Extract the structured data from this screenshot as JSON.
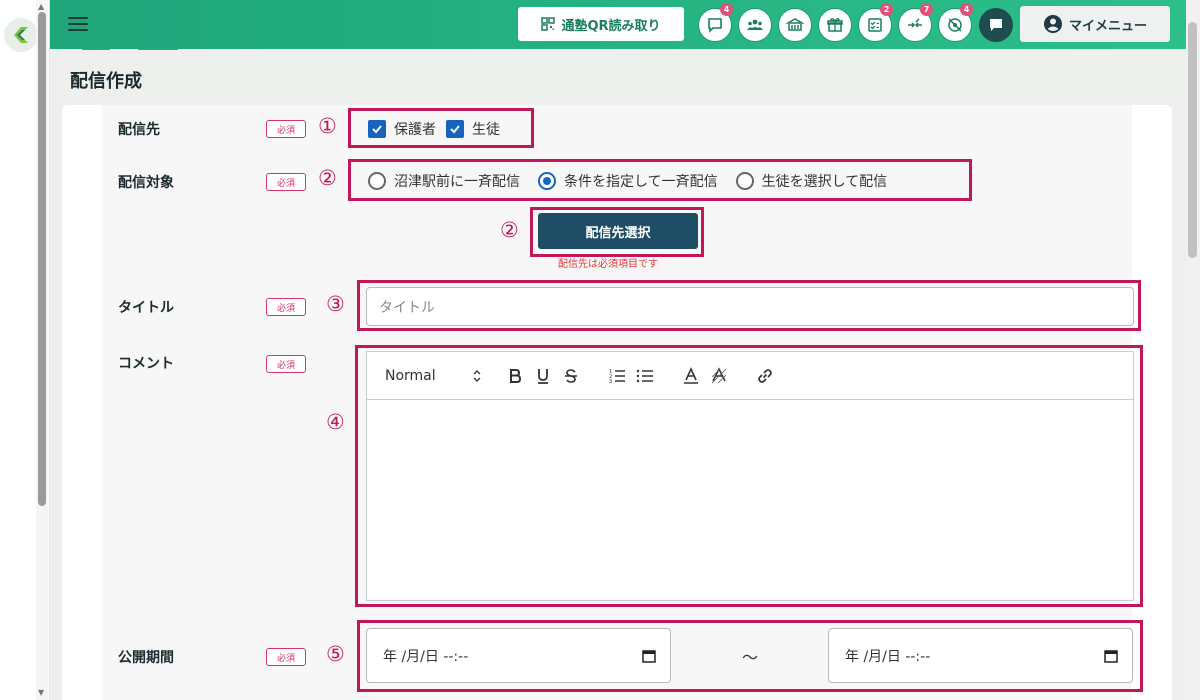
{
  "topbar": {
    "qr_button_label": "通塾QR読み取り",
    "icon_buttons": [
      {
        "name": "chat-icon",
        "badge": "4"
      },
      {
        "name": "group-icon",
        "badge": ""
      },
      {
        "name": "school-icon",
        "badge": ""
      },
      {
        "name": "gift-icon",
        "badge": ""
      },
      {
        "name": "checklist-icon",
        "badge": "2"
      },
      {
        "name": "transfer-icon",
        "badge": "7"
      },
      {
        "name": "location-off-icon",
        "badge": "4"
      }
    ],
    "mymenu_label": "マイメニュー"
  },
  "page": {
    "title": "配信作成"
  },
  "form": {
    "destination": {
      "label": "配信先",
      "required": "必須",
      "marker": "①",
      "options": [
        "保護者",
        "生徒"
      ],
      "checked": [
        true,
        true
      ]
    },
    "target": {
      "label": "配信対象",
      "required": "必須",
      "marker": "②",
      "options": [
        "沼津駅前に一斉配信",
        "条件を指定して一斉配信",
        "生徒を選択して配信"
      ],
      "selected_index": 1
    },
    "select_button": {
      "marker": "②",
      "label": "配信先選択",
      "error": "配信先は必須項目です"
    },
    "title": {
      "label": "タイトル",
      "required": "必須",
      "marker": "③",
      "placeholder": "タイトル"
    },
    "comment": {
      "label": "コメント",
      "required": "必須",
      "marker": "④",
      "format_select": "Normal"
    },
    "period": {
      "label": "公開期間",
      "required": "必須",
      "marker": "⑤",
      "start_value": "年 /月/日 --:--",
      "separator": "～",
      "end_value": "年 /月/日 --:--"
    }
  },
  "colors": {
    "topbar": "#1fa67a",
    "highlight": "#c2185b",
    "primary_button": "#1f4d66",
    "checkbox": "#1565c0"
  }
}
